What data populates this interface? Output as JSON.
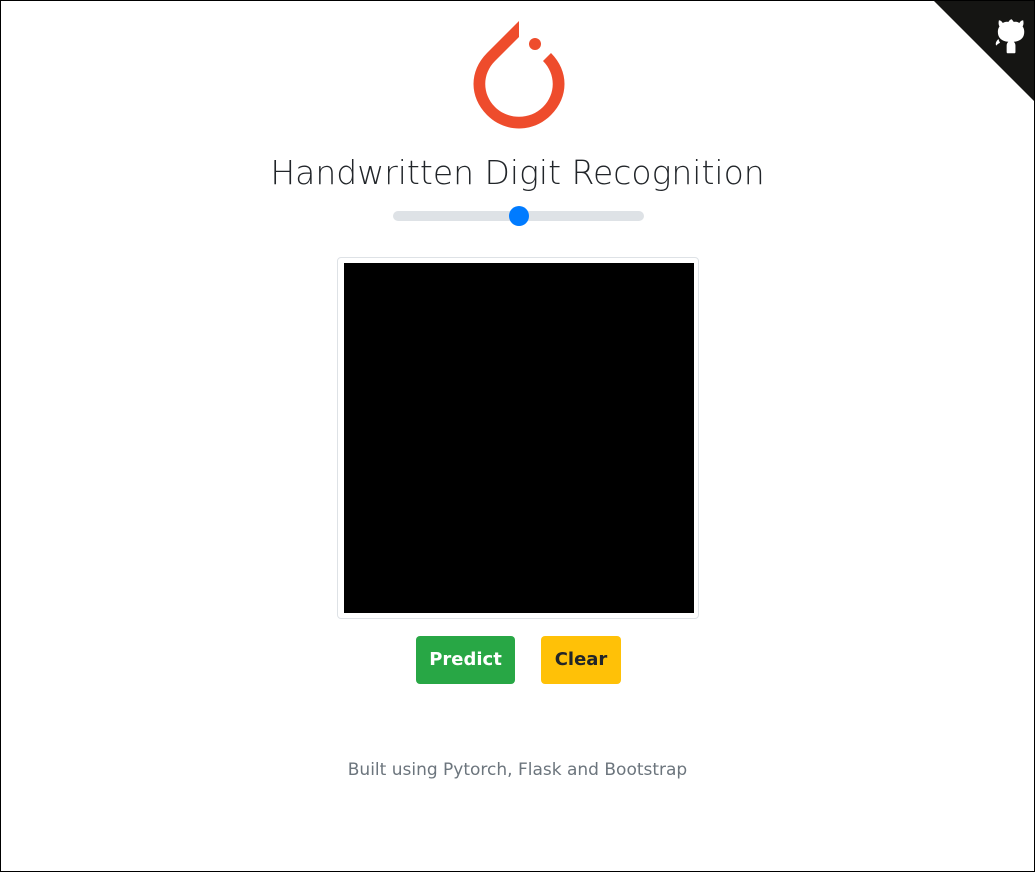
{
  "page": {
    "title": "Handwritten Digit Recognition",
    "footer": "Built using Pytorch, Flask and Bootstrap"
  },
  "logo": {
    "icon": "pytorch-logo-icon",
    "color": "#ee4c2c"
  },
  "github_corner": {
    "icon": "github-octocat-icon",
    "background": "#151513",
    "foreground": "#ffffff"
  },
  "brush_slider": {
    "value_fraction": 0.5,
    "track_color": "#dee2e6",
    "thumb_color": "#007bff"
  },
  "canvas": {
    "background": "#000000"
  },
  "buttons": {
    "predict_label": "Predict",
    "predict_color": "#28a745",
    "clear_label": "Clear",
    "clear_color": "#ffc107"
  }
}
